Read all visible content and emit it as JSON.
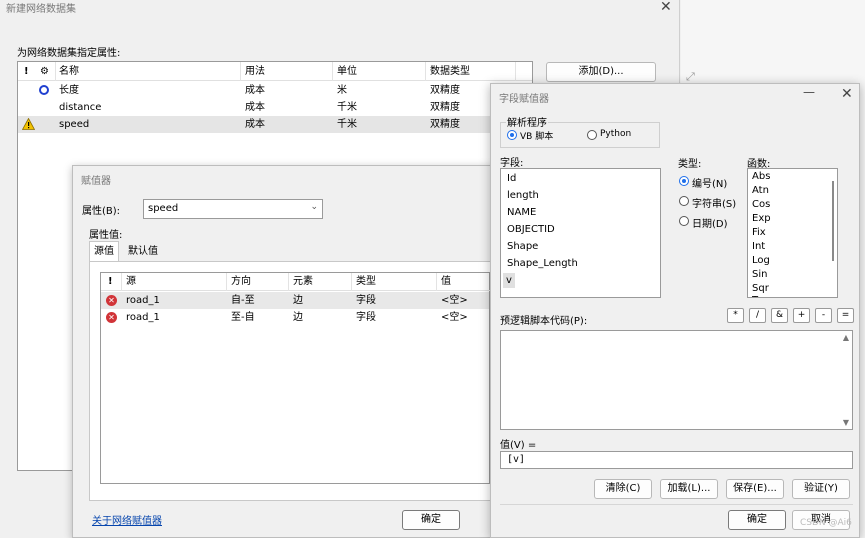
{
  "wizard": {
    "title": "新建网络数据集",
    "prompt": "为网络数据集指定属性:",
    "columns": [
      "!",
      "⚙",
      "名称",
      "用法",
      "单位",
      "数据类型"
    ],
    "rows": [
      {
        "warn": "",
        "icon": "gear",
        "name": "长度",
        "usage": "成本",
        "unit": "米",
        "dtype": "双精度"
      },
      {
        "warn": "",
        "icon": "",
        "name": "distance",
        "usage": "成本",
        "unit": "千米",
        "dtype": "双精度"
      },
      {
        "warn": "warning",
        "icon": "",
        "name": "speed",
        "usage": "成本",
        "unit": "千米",
        "dtype": "双精度"
      }
    ],
    "add_button": "添加(D)..."
  },
  "evaluator": {
    "title": "赋值器",
    "attr_label": "属性(B):",
    "attr_value": "speed",
    "attr_values_label": "属性值:",
    "tabs": [
      "源值",
      "默认值"
    ],
    "columns": [
      "!",
      "源",
      "方向",
      "元素",
      "类型",
      "值"
    ],
    "rows": [
      {
        "status": "error",
        "source": "road_1",
        "direction": "自-至",
        "element": "边",
        "type": "字段",
        "value": "<空>"
      },
      {
        "status": "error",
        "source": "road_1",
        "direction": "至-自",
        "element": "边",
        "type": "字段",
        "value": "<空>"
      }
    ],
    "link": "关于网络赋值器",
    "ok": "确定"
  },
  "field_calc": {
    "title": "字段赋值器",
    "parser_label": "解析程序",
    "parser_options": [
      "VB 脚本",
      "Python"
    ],
    "fields_label": "字段:",
    "fields": [
      "Id",
      "length",
      "NAME",
      "OBJECTID",
      "Shape",
      "Shape_Length",
      "v"
    ],
    "type_label": "类型:",
    "types": [
      "编号(N)",
      "字符串(S)",
      "日期(D)"
    ],
    "functions_label": "函数:",
    "functions": [
      "Abs",
      "Atn",
      "Cos",
      "Exp",
      "Fix",
      "Int",
      "Log",
      "Sin",
      "Sqr",
      "Tan"
    ],
    "prelogic_label": "预逻辑脚本代码(P):",
    "operators": [
      "*",
      "/",
      "&",
      "+",
      "-",
      "="
    ],
    "value_label": "值(V) =",
    "value_expr": "[v]",
    "clear": "清除(C)",
    "load": "加载(L)...",
    "save": "保存(E)...",
    "verify": "验证(Y)",
    "ok": "确定",
    "cancel": "取消"
  },
  "watermark": "CSDN @Ai6"
}
